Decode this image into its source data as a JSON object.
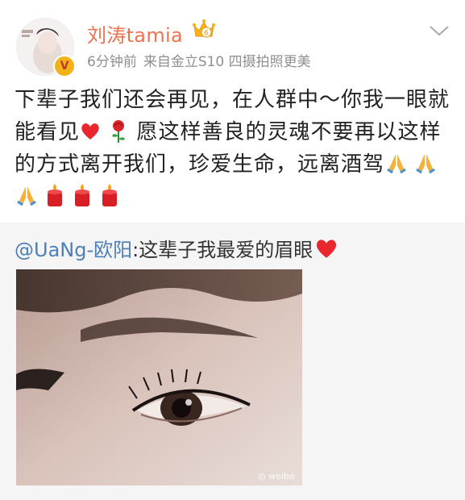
{
  "post": {
    "username": "刘涛tamia",
    "time": "6分钟前",
    "source": "来自金立S10 四摄拍照更美",
    "verified_badge": "V",
    "text_part1": "下辈子我们还会再见，在人群中～你我一眼就能看见",
    "text_part2": "愿这样善良的灵魂不要再以这样的方式离开我们，珍爱生命，远离酒驾",
    "icons": {
      "avatar": "avatar-photo",
      "crown": "crown-icon",
      "menu": "chevron-down-icon",
      "emoji_after_text": [
        "heart-emoji",
        "rose-emoji"
      ],
      "emoji_end": [
        "pray-emoji",
        "pray-emoji",
        "pray-emoji",
        "candle-emoji",
        "candle-emoji",
        "candle-emoji"
      ]
    }
  },
  "repost": {
    "mention": "@UaNg-欧阳",
    "text": ":这辈子我最爱的眉眼",
    "emoji": "heart-emoji",
    "image": "eye-closeup-photo"
  },
  "colors": {
    "username": "#eb7350",
    "meta": "#8f8f8f",
    "body": "#222222",
    "mention": "#4d7fb5",
    "repost_bg": "#f5f5f5",
    "heart": "#e8262e",
    "badge": "#f3b318"
  }
}
